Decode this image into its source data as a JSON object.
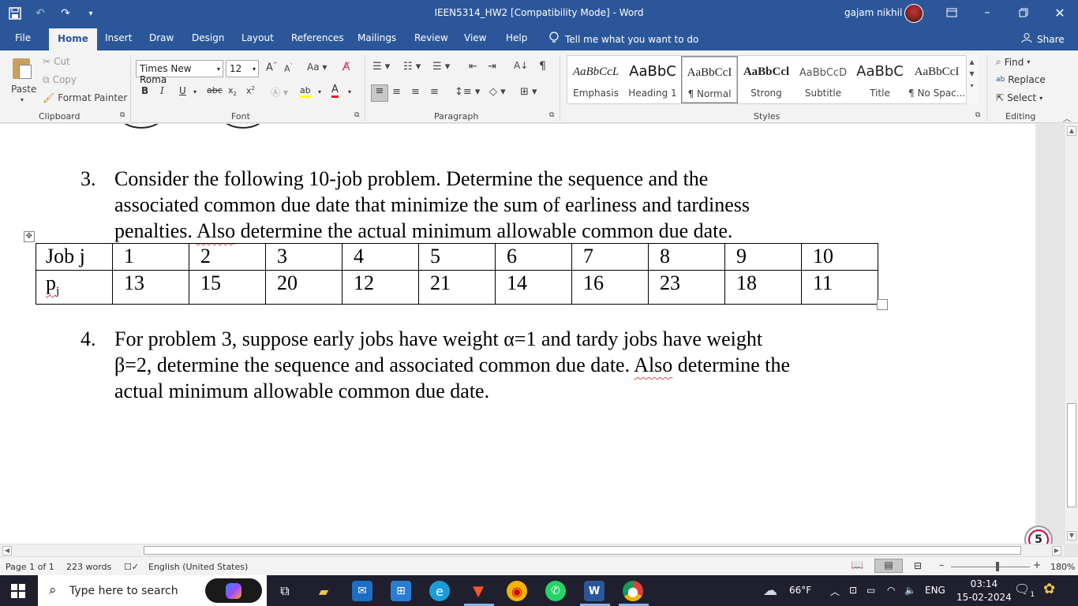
{
  "window": {
    "title": "IEEN5314_HW2 [Compatibility Mode]  -  Word",
    "user": "gajam nikhil"
  },
  "tabs": [
    "File",
    "Home",
    "Insert",
    "Draw",
    "Design",
    "Layout",
    "References",
    "Mailings",
    "Review",
    "View",
    "Help"
  ],
  "tell_me": "Tell me what you want to do",
  "share": "Share",
  "ribbon": {
    "clipboard": {
      "paste": "Paste",
      "cut": "Cut",
      "copy": "Copy",
      "format_painter": "Format Painter",
      "label": "Clipboard"
    },
    "font": {
      "name": "Times New Roma",
      "size": "12",
      "label": "Font"
    },
    "paragraph": {
      "label": "Paragraph"
    },
    "styles": {
      "label": "Styles",
      "items": [
        {
          "preview": "AaBbCcL",
          "name": "Emphasis"
        },
        {
          "preview": "AaBbC",
          "name": "Heading 1"
        },
        {
          "preview": "AaBbCcI",
          "name": "¶ Normal"
        },
        {
          "preview": "AaBbCcl",
          "name": "Strong"
        },
        {
          "preview": "AaBbCcD",
          "name": "Subtitle"
        },
        {
          "preview": "AaBbC",
          "name": "Title"
        },
        {
          "preview": "AaBbCcI",
          "name": "¶ No Spac..."
        }
      ]
    },
    "editing": {
      "find": "Find",
      "replace": "Replace",
      "select": "Select",
      "label": "Editing"
    }
  },
  "document": {
    "q3": {
      "number": "3.",
      "line1": "Consider the following 10-job problem. Determine the sequence and the",
      "line2": "associated common due date that minimize the sum of earliness and tardiness",
      "line3_a": "penalties. ",
      "line3_b": "Also",
      "line3_c": " determine the actual minimum allowable common due date."
    },
    "table": {
      "header_label": "Job j",
      "jobs": [
        "1",
        "2",
        "3",
        "4",
        "5",
        "6",
        "7",
        "8",
        "9",
        "10"
      ],
      "row_label": "p",
      "row_label_sub": "j",
      "times": [
        "13",
        "15",
        "20",
        "12",
        "21",
        "14",
        "16",
        "23",
        "18",
        "11"
      ]
    },
    "q4": {
      "number": "4.",
      "line1": "For problem 3, suppose early jobs have weight α=1 and tardy jobs have weight",
      "line2_a": "β=2, determine the sequence and associated common due date. ",
      "line2_b": "Also",
      "line2_c": " determine the",
      "line3": "actual minimum allowable common due date."
    }
  },
  "badge": "5",
  "status": {
    "page": "Page 1 of 1",
    "words": "223 words",
    "language": "English (United States)",
    "zoom": "180%"
  },
  "taskbar": {
    "search_placeholder": "Type here to search",
    "weather": "66°F",
    "lang": "ENG",
    "time": "03:14",
    "date": "15-02-2024",
    "notifications": "1"
  },
  "colors": {
    "word_blue": "#2b579a",
    "taskbar": "#1f1f2e"
  }
}
